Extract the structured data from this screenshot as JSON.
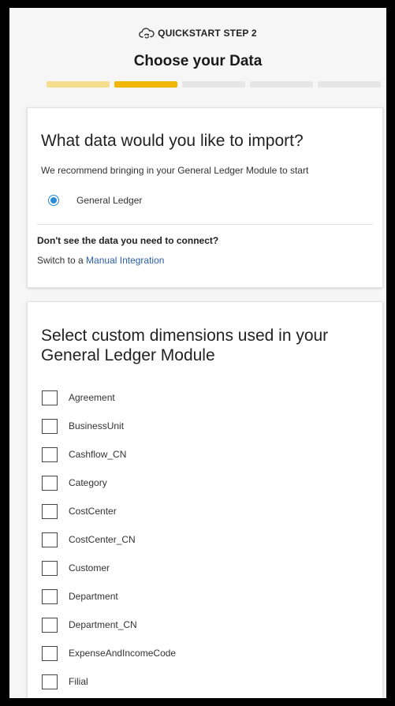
{
  "header": {
    "step_label": "QUICKSTART STEP 2",
    "title": "Choose your Data",
    "step_icon": "cloud-sync-icon"
  },
  "progress": {
    "current_step": 2,
    "total_steps": 5,
    "colors": {
      "completed": "#f7de8f",
      "active": "#f2b705",
      "pending": "#e6e6e6"
    }
  },
  "import_card": {
    "title": "What data would you like to import?",
    "subtext": "We recommend bringing in your General Ledger Module to start",
    "option_label": "General Ledger",
    "option_selected": true,
    "notice_title": "Don't see the data you need to connect?",
    "notice_prefix": "Switch to a",
    "notice_link": "Manual Integration"
  },
  "dimensions_card": {
    "title": "Select custom dimensions used in your General Ledger Module",
    "items": [
      "Agreement",
      "BusinessUnit",
      "Cashflow_CN",
      "Category",
      "CostCenter",
      "CostCenter_CN",
      "Customer",
      "Department",
      "Department_CN",
      "ExpenseAndIncomeCode",
      "Filial"
    ]
  },
  "colors": {
    "accent": "#2a8bd6",
    "link": "#2b5ea7"
  }
}
